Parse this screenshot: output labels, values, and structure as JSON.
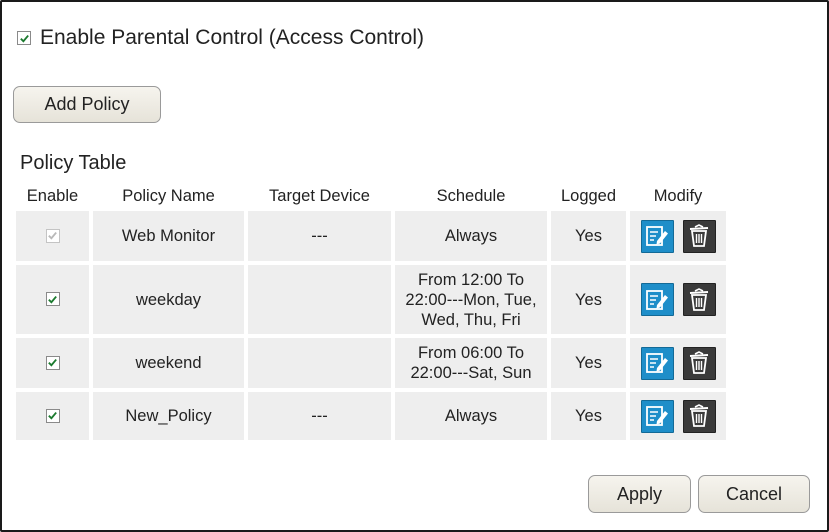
{
  "parental_control": {
    "enable_label": "Enable Parental Control (Access Control)",
    "enabled": true
  },
  "buttons": {
    "add_policy": "Add Policy",
    "apply": "Apply",
    "cancel": "Cancel"
  },
  "policy_table": {
    "caption": "Policy Table",
    "headers": [
      "Enable",
      "Policy Name",
      "Target Device",
      "Schedule",
      "Logged",
      "Modify"
    ],
    "rows": [
      {
        "enabled": true,
        "enable_disabled": true,
        "name": "Web Monitor",
        "target": "---",
        "schedule": [
          "Always"
        ],
        "logged": "Yes"
      },
      {
        "enabled": true,
        "enable_disabled": false,
        "name": "weekday",
        "target": "",
        "schedule": [
          "From 12:00 To",
          "22:00---Mon, Tue,",
          "Wed, Thu, Fri"
        ],
        "logged": "Yes"
      },
      {
        "enabled": true,
        "enable_disabled": false,
        "name": "weekend",
        "target": "",
        "schedule": [
          "From 06:00 To",
          "22:00---Sat, Sun"
        ],
        "logged": "Yes"
      },
      {
        "enabled": true,
        "enable_disabled": false,
        "name": "New_Policy",
        "target": "---",
        "schedule": [
          "Always"
        ],
        "logged": "Yes"
      }
    ]
  },
  "icons": {
    "edit": "edit-icon",
    "delete": "trash-icon"
  },
  "colors": {
    "edit_icon_bg": "#1e8ec9",
    "delete_icon_bg": "#3a3a3a",
    "checkbox_check": "#1b7a2e",
    "cell_bg": "#eeeeee"
  }
}
